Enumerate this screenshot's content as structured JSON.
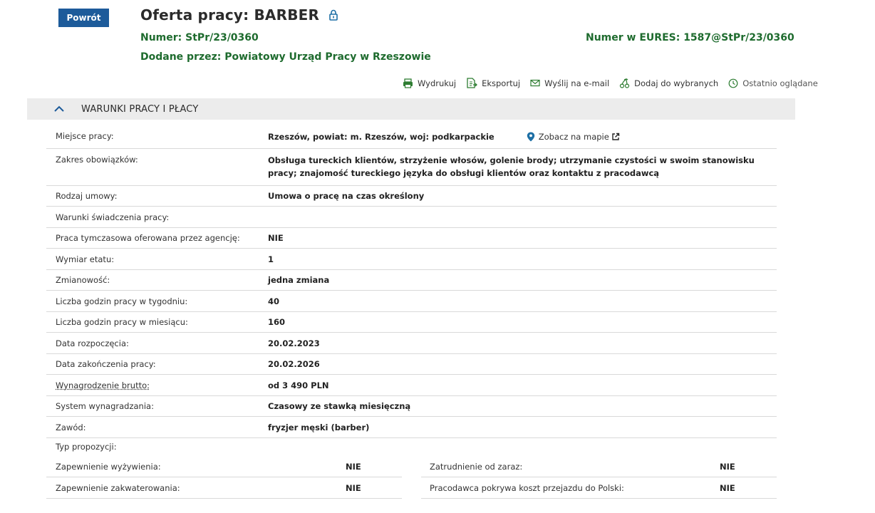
{
  "header": {
    "back_label": "Powrót",
    "title": "Oferta pracy: BARBER",
    "numer_label": "Numer:",
    "numer_value": "StPr/23/0360",
    "eures_label": "Numer w EURES:",
    "eures_value": "1587@StPr/23/0360",
    "dodane_label": "Dodane przez:",
    "dodane_value": "Powiatowy Urząd Pracy w Rzeszowie"
  },
  "actions": [
    {
      "label": "Wydrukuj",
      "icon": "printer-icon"
    },
    {
      "label": "Eksportuj",
      "icon": "export-icon"
    },
    {
      "label": "Wyślij na e-mail",
      "icon": "envelope-icon"
    },
    {
      "label": "Dodaj do wybranych",
      "icon": "cherries-icon"
    },
    {
      "label": "Ostatnio oglądane",
      "icon": "clock-icon"
    }
  ],
  "section": {
    "title": "WARUNKI PRACY I PŁACY"
  },
  "rows": [
    {
      "key": "Miejsce pracy:",
      "value": "Rzeszów, powiat: m. Rzeszów, woj: podkarpackie",
      "map_link": "Zobacz na mapie"
    },
    {
      "key": "Zakres obowiązków:",
      "value": "Obsługa tureckich klientów, strzyżenie włosów, golenie brody; utrzymanie czystości w swoim stanowisku pracy; znajomość tureckiego języka do obsługi klientów oraz kontaktu z pracodawcą"
    },
    {
      "key": "Rodzaj umowy:",
      "value": "Umowa o pracę na czas określony"
    },
    {
      "key": "Warunki świadczenia pracy:",
      "value": ""
    },
    {
      "key": "Praca tymczasowa oferowana przez agencję:",
      "value": "NIE"
    },
    {
      "key": "Wymiar etatu:",
      "value": "1"
    },
    {
      "key": "Zmianowość:",
      "value": "jedna zmiana"
    },
    {
      "key": "Liczba godzin pracy w tygodniu:",
      "value": "40"
    },
    {
      "key": "Liczba godzin pracy w miesiącu:",
      "value": "160"
    },
    {
      "key": "Data rozpoczęcia:",
      "value": "20.02.2023"
    },
    {
      "key": "Data zakończenia pracy:",
      "value": "20.02.2026"
    },
    {
      "key": "Wynagrodzenie brutto:",
      "value": "od 3 490 PLN"
    },
    {
      "key": "System wynagradzania:",
      "value": "Czasowy ze stawką miesięczną"
    },
    {
      "key": "Zawód:",
      "value": "fryzjer męski (barber)"
    }
  ],
  "typ_propozycji": {
    "label": "Typ propozycji:",
    "left": [
      {
        "key": "Zapewnienie wyżywienia:",
        "value": "NIE"
      },
      {
        "key": "Zapewnienie zakwaterowania:",
        "value": "NIE"
      }
    ],
    "right": [
      {
        "key": "Zatrudnienie od zaraz:",
        "value": "NIE"
      },
      {
        "key": "Pracodawca pokrywa koszt przejazdu do Polski:",
        "value": "NIE"
      }
    ]
  },
  "colors": {
    "accent_button": "#1d5b9a",
    "meta_green": "#1e6b2e",
    "section_bg": "#ececec",
    "icon_green": "#2e7d32",
    "map_pin": "#1d6fa5"
  }
}
